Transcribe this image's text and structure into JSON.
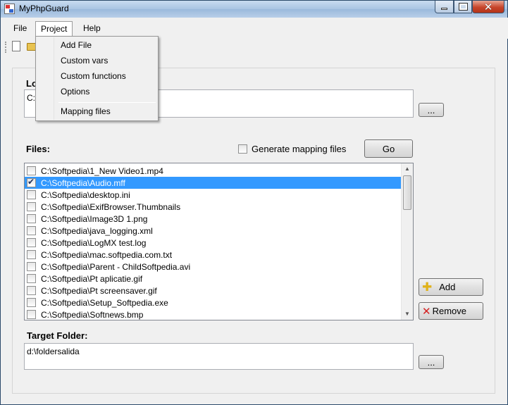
{
  "window": {
    "title": "MyPhpGuard"
  },
  "menubar": {
    "items": [
      "File",
      "Project",
      "Help"
    ]
  },
  "project_menu": {
    "items": [
      "Add File",
      "Custom vars",
      "Custom functions",
      "Options",
      "Mapping files"
    ]
  },
  "location": {
    "label": "Lo",
    "value": "C:",
    "browse_label": "..."
  },
  "files": {
    "label": "Files:",
    "generate_mapping_label": "Generate mapping files",
    "generate_mapping_checked": false,
    "go_label": "Go",
    "items": [
      {
        "path": "C:\\Softpedia\\1_New Video1.mp4",
        "checked": false,
        "selected": false
      },
      {
        "path": "C:\\Softpedia\\Audio.mff",
        "checked": true,
        "selected": true
      },
      {
        "path": "C:\\Softpedia\\desktop.ini",
        "checked": false,
        "selected": false
      },
      {
        "path": "C:\\Softpedia\\ExifBrowser.Thumbnails",
        "checked": false,
        "selected": false
      },
      {
        "path": "C:\\Softpedia\\Image3D 1.png",
        "checked": false,
        "selected": false
      },
      {
        "path": "C:\\Softpedia\\java_logging.xml",
        "checked": false,
        "selected": false
      },
      {
        "path": "C:\\Softpedia\\LogMX test.log",
        "checked": false,
        "selected": false
      },
      {
        "path": "C:\\Softpedia\\mac.softpedia.com.txt",
        "checked": false,
        "selected": false
      },
      {
        "path": "C:\\Softpedia\\Parent - ChildSoftpedia.avi",
        "checked": false,
        "selected": false
      },
      {
        "path": "C:\\Softpedia\\Pt aplicatie.gif",
        "checked": false,
        "selected": false
      },
      {
        "path": "C:\\Softpedia\\Pt screensaver.gif",
        "checked": false,
        "selected": false
      },
      {
        "path": "C:\\Softpedia\\Setup_Softpedia.exe",
        "checked": false,
        "selected": false
      },
      {
        "path": "C:\\Softpedia\\Softnews.bmp",
        "checked": false,
        "selected": false
      }
    ],
    "add_label": "Add",
    "remove_label": "Remove"
  },
  "target": {
    "label": "Target Folder:",
    "value": "d:\\foldersalida",
    "browse_label": "..."
  },
  "icons": [
    "app-icon",
    "minimize-icon",
    "maximize-icon",
    "close-icon",
    "new-file-icon",
    "open-folder-icon",
    "scroll-up-icon",
    "scroll-down-icon",
    "plus-icon",
    "x-icon"
  ]
}
